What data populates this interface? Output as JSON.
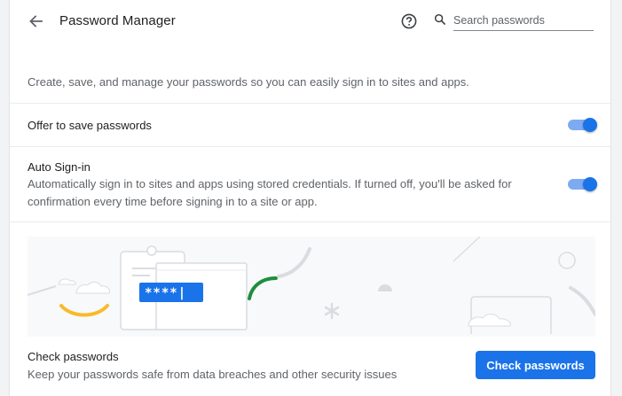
{
  "header": {
    "title": "Password Manager",
    "back_icon": "arrow-left-icon",
    "help_icon": "help-circle-icon",
    "search_icon": "magnifier-icon",
    "search_placeholder": "Search passwords",
    "search_value": ""
  },
  "intro": "Create, save, and manage your passwords so you can easily sign in to sites and apps.",
  "settings": [
    {
      "label": "Offer to save passwords",
      "enabled": true
    },
    {
      "label": "Auto Sign-in",
      "description": "Automatically sign in to sites and apps using stored credentials. If turned off, you'll be asked for confirmation every time before signing in to a site or app.",
      "enabled": true
    }
  ],
  "banner": {
    "masked_password": "****|"
  },
  "check": {
    "title": "Check passwords",
    "description": "Keep your passwords safe from data breaches and other security issues",
    "button_label": "Check passwords"
  },
  "colors": {
    "accent": "#1a73e8",
    "toggle_track": "#7eaaf1",
    "illustration_green": "#1e8e3e",
    "illustration_yellow": "#f9ba2a"
  }
}
